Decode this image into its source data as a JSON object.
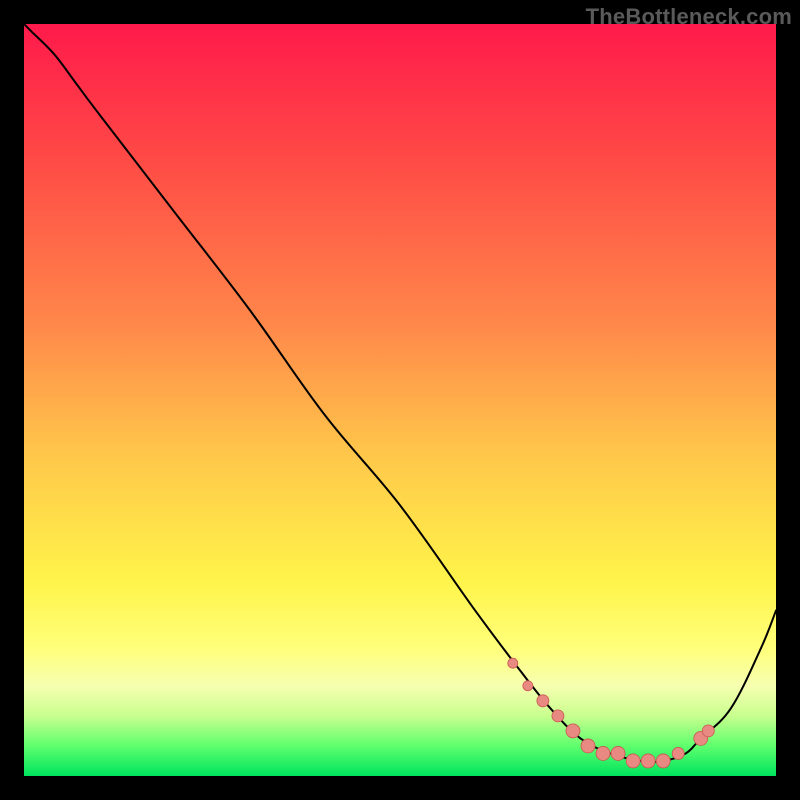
{
  "watermark": "TheBottleneck.com",
  "colors": {
    "dot_fill": "#e88a82",
    "dot_stroke": "#c95950",
    "line": "#000000",
    "gradient": [
      "#ff1a4b",
      "#ff884a",
      "#fff44a",
      "#00e35e"
    ]
  },
  "chart_data": {
    "type": "line",
    "title": "",
    "xlabel": "",
    "ylabel": "",
    "xlim": [
      0,
      100
    ],
    "ylim": [
      0,
      100
    ],
    "series": [
      {
        "name": "curve",
        "x": [
          0,
          1,
          4,
          7,
          10,
          20,
          30,
          40,
          50,
          60,
          66,
          70,
          74,
          78,
          82,
          85,
          88,
          90,
          94,
          98,
          100
        ],
        "y": [
          100,
          99,
          96,
          92,
          88,
          75,
          62,
          48,
          36,
          22,
          14,
          9,
          5,
          3,
          2,
          2,
          3,
          5,
          9,
          17,
          22
        ]
      }
    ],
    "highlight_points": {
      "name": "dots",
      "x": [
        65,
        67,
        69,
        71,
        73,
        75,
        77,
        79,
        81,
        83,
        85,
        87,
        90,
        91
      ],
      "y": [
        15,
        12,
        10,
        8,
        6,
        4,
        3,
        3,
        2,
        2,
        2,
        3,
        5,
        6
      ],
      "r": [
        5,
        5,
        6,
        6,
        7,
        7,
        7,
        7,
        7,
        7,
        7,
        6,
        7,
        6
      ]
    }
  }
}
